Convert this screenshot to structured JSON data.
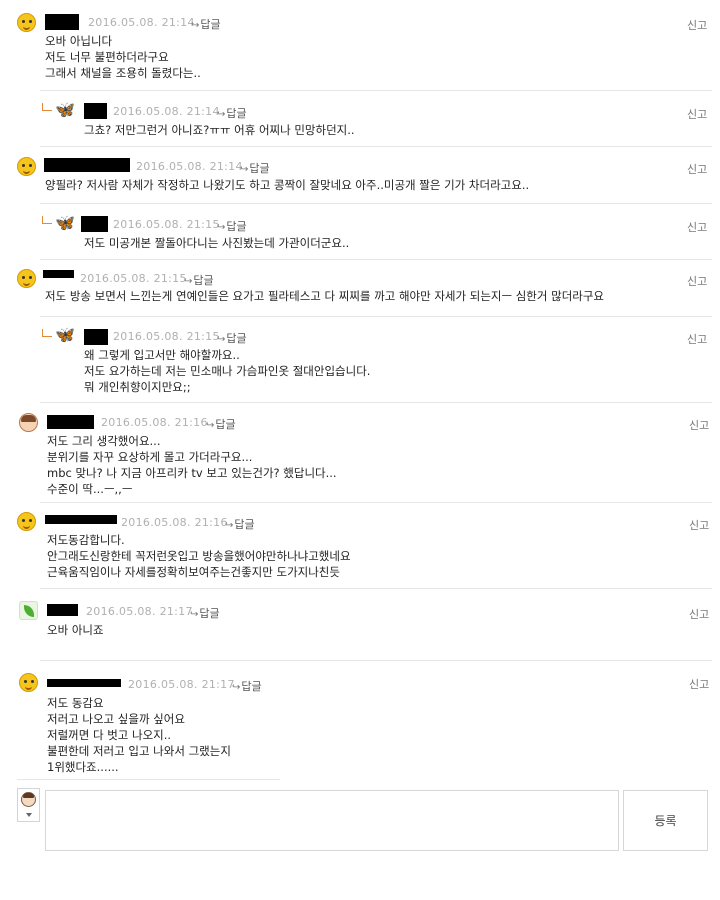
{
  "comments": [
    {
      "time": "2016.05.08. 21:14",
      "reply": "답글",
      "report": "신고",
      "icon": "yellow-smiley-avatar-icon",
      "body": "오바 아닙니다\n저도 너무 불편하더라구요\n그래서 채널을 조용히 돌렸다는.."
    },
    {
      "time": "2016.05.08. 21:14",
      "reply": "답글",
      "report": "신고",
      "icon": "butterfly-avatar-icon",
      "body": "그쵸? 저만그런거 아니죠?ㅠㅠ 어휴 어찌나 민망하던지.."
    },
    {
      "time": "2016.05.08. 21:14",
      "reply": "답글",
      "report": "신고",
      "icon": "yellow-smiley-avatar-icon",
      "body": "양필라? 저사람 자체가 작정하고 나왔기도 하고 콩짝이 잘맞네요 아주..미공개 짤은 기가 차더라고요.."
    },
    {
      "time": "2016.05.08. 21:15",
      "reply": "답글",
      "report": "신고",
      "icon": "butterfly-avatar-icon",
      "body": "저도 미공개본 짤돌아다니는 사진봤는데 가관이더군요.."
    },
    {
      "time": "2016.05.08. 21:15",
      "reply": "답글",
      "report": "신고",
      "icon": "yellow-smiley-avatar-icon",
      "body": "저도 방송 보면서 느낀는게 연예인들은 요가고 필라테스고 다 찌찌를 까고 해야만 자세가 되는지ㅡ 심한거 많더라구요"
    },
    {
      "time": "2016.05.08. 21:15",
      "reply": "답글",
      "report": "신고",
      "icon": "butterfly-avatar-icon",
      "body": "왜 그렇게 입고서만 해야할까요..\n저도 요가하는데 저는 민소매나 가슴파인옷 절대안입습니다.\n뭐 개인취향이지만요;;"
    },
    {
      "time": "2016.05.08. 21:16",
      "reply": "답글",
      "report": "신고",
      "icon": "girl-avatar-icon",
      "body": "저도 그리 생각했어요...\n분위기를 자꾸 요상하게 몰고 가더라구요...\nmbc 맞나? 나 지금 아프리카 tv 보고 있는건가? 했답니다...\n수준이 딱...ㅡ,,ㅡ"
    },
    {
      "time": "2016.05.08. 21:16",
      "reply": "답글",
      "report": "신고",
      "icon": "yellow-smiley-avatar-icon",
      "body": "저도동감합니다.\n안그래도신랑한테 꼭저런옷입고 방송을했어야만하나냐고했네요\n근육움직임이나 자세를정확히보여주는건좋지만 도가지나친듯"
    },
    {
      "time": "2016.05.08. 21:17",
      "reply": "답글",
      "report": "신고",
      "icon": "leaf-avatar-icon",
      "body": "오바 아니죠"
    },
    {
      "time": "2016.05.08. 21:17",
      "reply": "답글",
      "report": "신고",
      "icon": "yellow-smiley-avatar-icon",
      "body": "저도 동감요\n저러고 나오고 싶을까 싶어요\n저럴꺼면 다 벗고 나오지..\n불편한데 저러고 입고 나와서 그랬는지\n1위했다죠......"
    }
  ],
  "composer": {
    "submit_label": "등록",
    "avatar_icon": "user-avatar-icon"
  }
}
